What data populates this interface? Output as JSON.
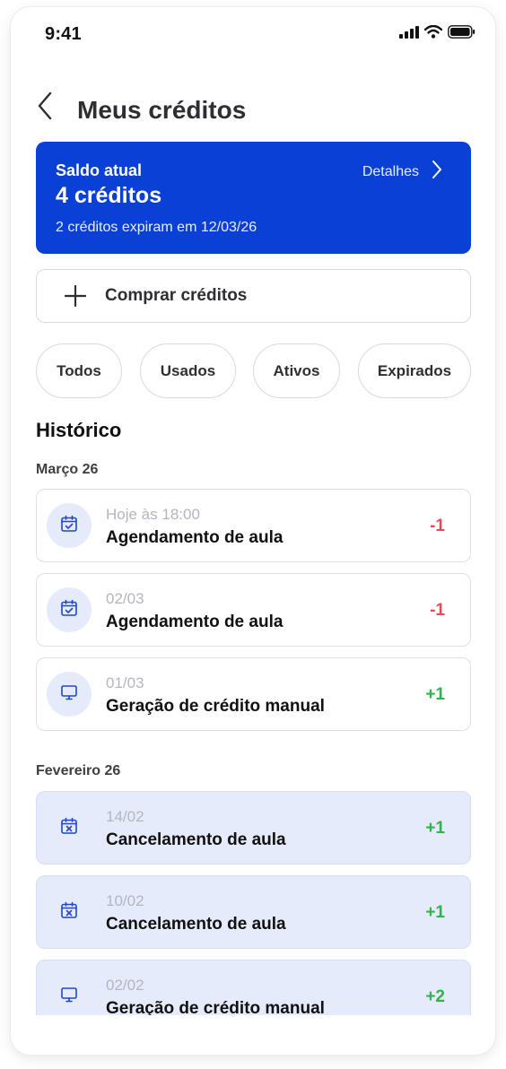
{
  "status": {
    "time": "9:41"
  },
  "header": {
    "title": "Meus créditos"
  },
  "balance": {
    "label": "Saldo atual",
    "value": "4 créditos",
    "expire_note": "2 créditos expiram em 12/03/26",
    "details_label": "Detalhes"
  },
  "buy": {
    "label": "Comprar créditos"
  },
  "filters": [
    "Todos",
    "Usados",
    "Ativos",
    "Expirados"
  ],
  "history": {
    "title": "Histórico",
    "groups": [
      {
        "label": "Março 26",
        "items": [
          {
            "date": "Hoje às 18:00",
            "description": "Agendamento de aula",
            "amount": "-1",
            "icon": "calendar-check-icon"
          },
          {
            "date": "02/03",
            "description": "Agendamento de aula",
            "amount": "-1",
            "icon": "calendar-check-icon"
          },
          {
            "date": "01/03",
            "description": "Geração de crédito manual",
            "amount": "+1",
            "icon": "monitor-icon"
          }
        ]
      },
      {
        "label": "Fevereiro 26",
        "items": [
          {
            "date": "14/02",
            "description": "Cancelamento de aula",
            "amount": "+1",
            "icon": "calendar-x-icon"
          },
          {
            "date": "10/02",
            "description": "Cancelamento de aula",
            "amount": "+1",
            "icon": "calendar-x-icon"
          },
          {
            "date": "02/02",
            "description": "Geração de crédito manual",
            "amount": "+2",
            "icon": "monitor-icon"
          }
        ]
      }
    ]
  },
  "colors": {
    "primary": "#0a40d6",
    "negative": "#e24b57",
    "positive": "#2fb34a",
    "refund_bg": "#e5ebfa"
  }
}
